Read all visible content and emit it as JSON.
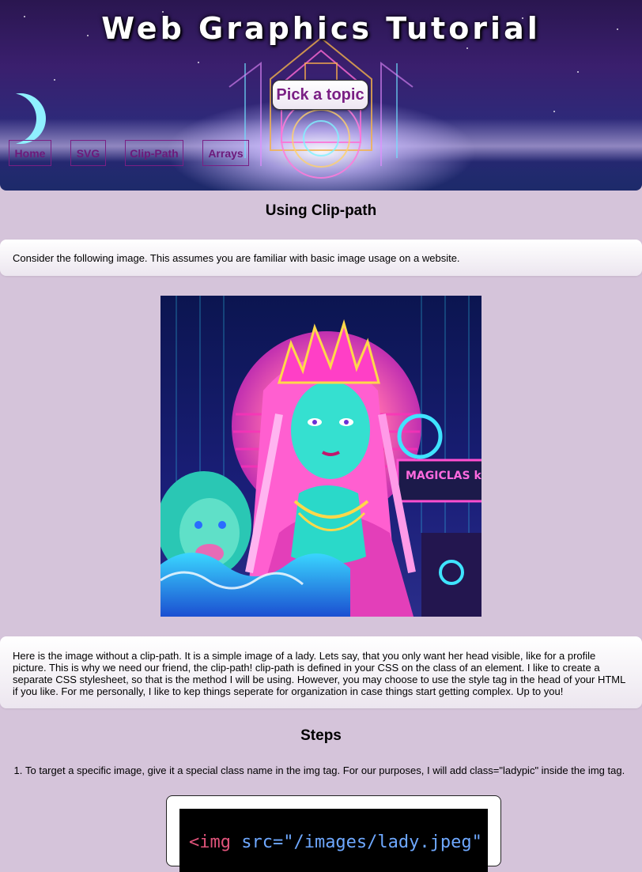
{
  "header": {
    "title": "Web Graphics Tutorial",
    "pick_topic_label": "Pick a topic",
    "nav": [
      {
        "label": "Home"
      },
      {
        "label": "SVG"
      },
      {
        "label": "Clip-Path"
      },
      {
        "label": "Arrays"
      }
    ]
  },
  "main": {
    "heading": "Using Clip-path",
    "intro": "Consider the following image. This assumes you are familiar with basic image usage on a website.",
    "image_caption_paragraph": "Here is the image without a clip-path. It is a simple image of a lady. Lets say, that you only want her head visible, like for a profile picture. This is why we need our friend, the clip-path! clip-path is defined in your CSS on the class of an element. I like to create a separate CSS stylesheet, so that is the method I will be using. However, you may choose to use the style tag in the head of your HTML if you like. For me personally, I like to kep things seperate for organization in case things start getting complex. Up to you!",
    "image_sign_text": "MAGICLAS kHINS",
    "steps_heading": "Steps",
    "steps": [
      "To target a specific image, give it a special class name in the img tag. For our purposes, I will add class=\"ladypic\" inside the img tag."
    ],
    "code_snippet": {
      "tag": "<img",
      "attr": " src=\"/images/lady.jpeg\""
    }
  },
  "colors": {
    "page_bg": "#d5c4da",
    "accent_purple": "#7a1f84",
    "banner_dark": "#2a1650"
  }
}
